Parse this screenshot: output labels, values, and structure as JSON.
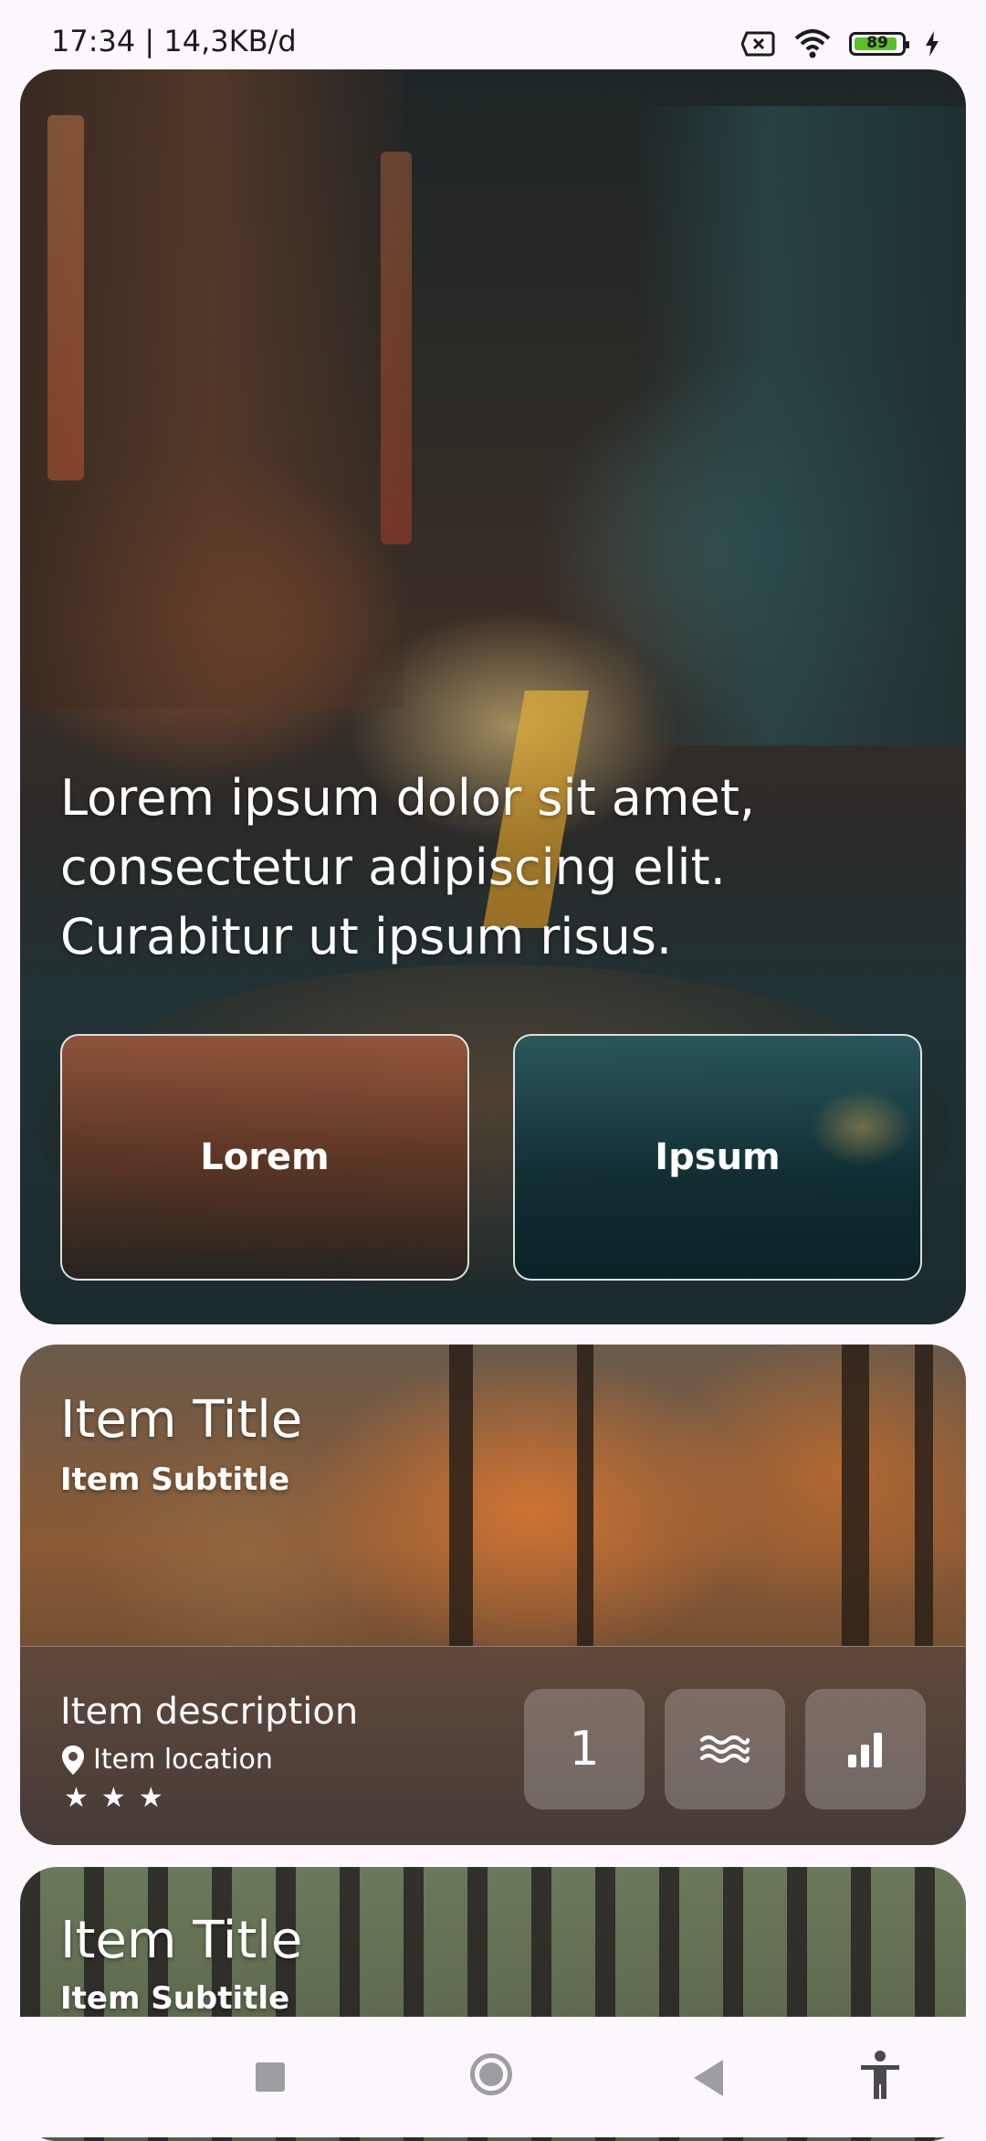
{
  "status_bar": {
    "time_and_speed": "17:34 | 14,3KB/d",
    "battery_level": "89",
    "icons": [
      "sim-off-icon",
      "wifi-icon",
      "battery-icon",
      "charging-bolt-icon"
    ]
  },
  "hero": {
    "text": "Lorem ipsum dolor sit amet, consectetur adipiscing elit. Curabitur ut ipsum risus.",
    "buttons": [
      {
        "label": "Lorem"
      },
      {
        "label": "Ipsum"
      }
    ]
  },
  "items": [
    {
      "title": "Item Title",
      "subtitle": "Item Subtitle",
      "description": "Item description",
      "location": "Item location",
      "rating_stars": 3,
      "tiles": [
        {
          "type": "text",
          "value": "1"
        },
        {
          "type": "icon",
          "icon": "waves-icon"
        },
        {
          "type": "icon",
          "icon": "signal-bars-icon"
        }
      ]
    },
    {
      "title": "Item Title",
      "subtitle": "Item Subtitle"
    }
  ],
  "nav": {
    "icons": [
      "recents-icon",
      "home-icon",
      "back-icon",
      "accessibility-icon"
    ]
  },
  "colors": {
    "background": "#fdf6fd",
    "battery_fill": "#5bbf2a",
    "nav_icon": "#9e9ea2"
  }
}
